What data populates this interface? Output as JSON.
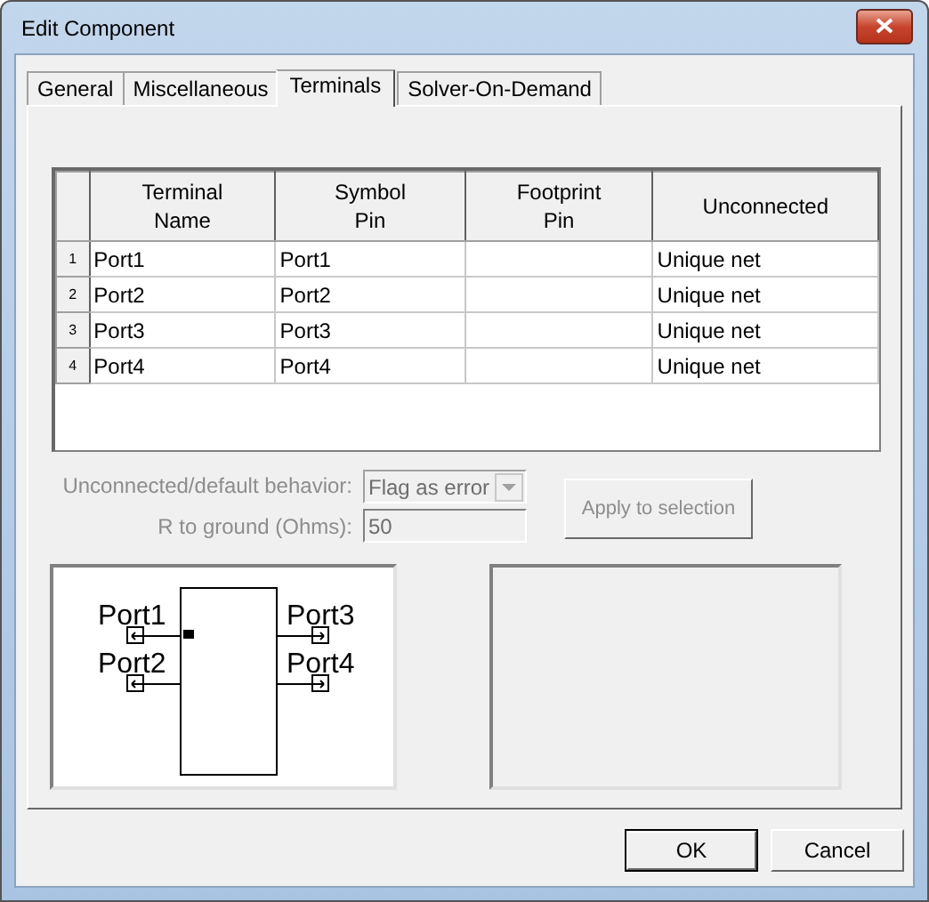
{
  "window": {
    "title": "Edit Component"
  },
  "tabs": [
    {
      "label": "General",
      "selected": false
    },
    {
      "label": "Miscellaneous",
      "selected": false
    },
    {
      "label": "Terminals",
      "selected": true
    },
    {
      "label": "Solver-On-Demand",
      "selected": false
    }
  ],
  "table": {
    "columns": [
      "Terminal\nName",
      "Symbol\nPin",
      "Footprint\nPin",
      "Unconnected"
    ],
    "rows": [
      {
        "number": "1",
        "terminal_name": "Port1",
        "symbol_pin": "Port1",
        "unconnected": "Unique net"
      },
      {
        "number": "2",
        "terminal_name": "Port2",
        "symbol_pin": "Port2",
        "unconnected": "Unique net"
      },
      {
        "number": "3",
        "terminal_name": "Port3",
        "symbol_pin": "Port3",
        "unconnected": "Unique net"
      },
      {
        "number": "4",
        "terminal_name": "Port4",
        "symbol_pin": "Port4",
        "unconnected": "Unique net"
      }
    ]
  },
  "settings": {
    "behavior_label": "Unconnected/default behavior:",
    "behavior_value": "Flag as error",
    "r_label": "R to ground (Ohms):",
    "r_value": "50",
    "apply_button": "Apply to selection",
    "disabled": true
  },
  "symbol": {
    "ports": [
      {
        "name": "Port1",
        "kind": "left"
      },
      {
        "name": "Port2",
        "kind": "left"
      },
      {
        "name": "Port3",
        "kind": "right"
      },
      {
        "name": "Port4",
        "kind": "right"
      }
    ]
  },
  "buttons": [
    {
      "label": "OK",
      "default": true
    },
    {
      "label": "Cancel",
      "default": false
    }
  ]
}
